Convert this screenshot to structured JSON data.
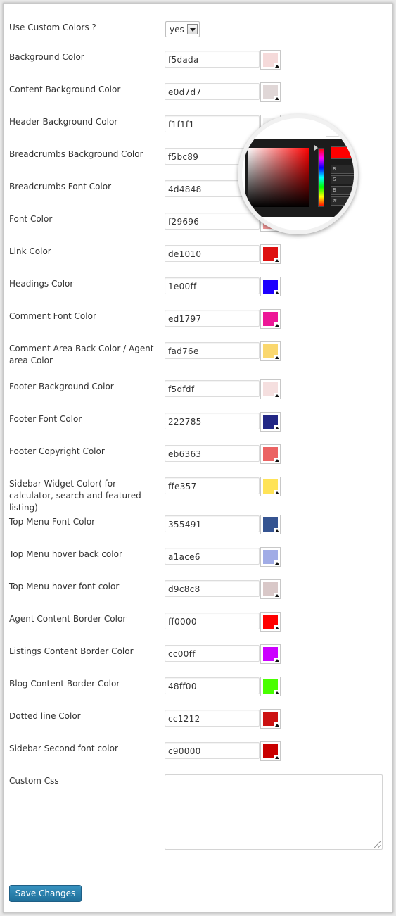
{
  "use_custom": {
    "label": "Use Custom Colors ?",
    "value": "yes"
  },
  "fields": [
    {
      "label": "Background Color",
      "value": "f5dada",
      "color": "#f5dada"
    },
    {
      "label": "Content Background Color",
      "value": "e0d7d7",
      "color": "#e0d7d7"
    },
    {
      "label": "Header Background Color",
      "value": "f1f1f1",
      "color": "#f1f1f1"
    },
    {
      "label": "Breadcrumbs Background Color",
      "value": "f5bc89",
      "color": "#f5bc89"
    },
    {
      "label": "Breadcrumbs Font Color",
      "value": "4d4848",
      "color": "#4d4848"
    },
    {
      "label": "Font Color",
      "value": "f29696",
      "color": "#f29696"
    },
    {
      "label": "Link Color",
      "value": "de1010",
      "color": "#de1010"
    },
    {
      "label": "Headings Color",
      "value": "1e00ff",
      "color": "#1e00ff"
    },
    {
      "label": "Comment Font Color",
      "value": "ed1797",
      "color": "#ed1797"
    },
    {
      "label": "Comment Area Back Color / Agent area Color",
      "value": "fad76e",
      "color": "#fad76e"
    },
    {
      "label": "Footer Background Color",
      "value": "f5dfdf",
      "color": "#f5dfdf"
    },
    {
      "label": "Footer Font Color",
      "value": "222785",
      "color": "#222785"
    },
    {
      "label": "Footer Copyright Color",
      "value": "eb6363",
      "color": "#eb6363"
    },
    {
      "label": "Sidebar Widget Color( for calculator, search and featured listing)",
      "value": "ffe357",
      "color": "#ffe357"
    },
    {
      "label": "Top Menu Font Color",
      "value": "355491",
      "color": "#355491"
    },
    {
      "label": "Top Menu hover back color",
      "value": "a1ace6",
      "color": "#a1ace6"
    },
    {
      "label": "Top Menu hover font color",
      "value": "d9c8c8",
      "color": "#d9c8c8"
    },
    {
      "label": "Agent Content Border Color",
      "value": "ff0000",
      "color": "#ff0000"
    },
    {
      "label": "Listings Content Border Color",
      "value": "cc00ff",
      "color": "#cc00ff"
    },
    {
      "label": "Blog Content Border Color",
      "value": "48ff00",
      "color": "#48ff00"
    },
    {
      "label": "Dotted line Color",
      "value": "cc1212",
      "color": "#cc1212"
    },
    {
      "label": "Sidebar Second font color",
      "value": "c90000",
      "color": "#c90000"
    }
  ],
  "custom_css": {
    "label": "Custom Css",
    "value": ""
  },
  "save_label": "Save Changes",
  "picker": {
    "fields": [
      "R",
      "G",
      "B",
      "#"
    ]
  }
}
